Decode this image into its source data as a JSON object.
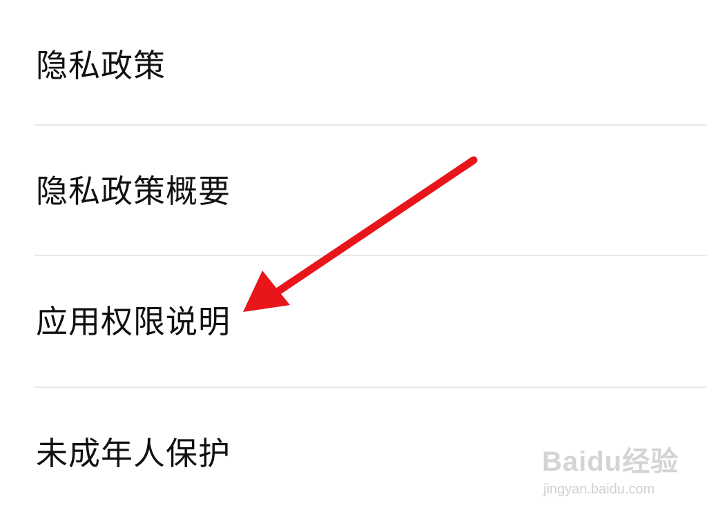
{
  "menu": {
    "items": [
      {
        "label": "隐私政策"
      },
      {
        "label": "隐私政策概要"
      },
      {
        "label": "应用权限说明"
      },
      {
        "label": "未成年人保护"
      }
    ]
  },
  "annotation": {
    "arrow_color": "#e8151b",
    "points_to": "应用权限说明"
  },
  "watermark": {
    "logo_text": "Baidu经验",
    "url": "jingyan.baidu.com"
  }
}
